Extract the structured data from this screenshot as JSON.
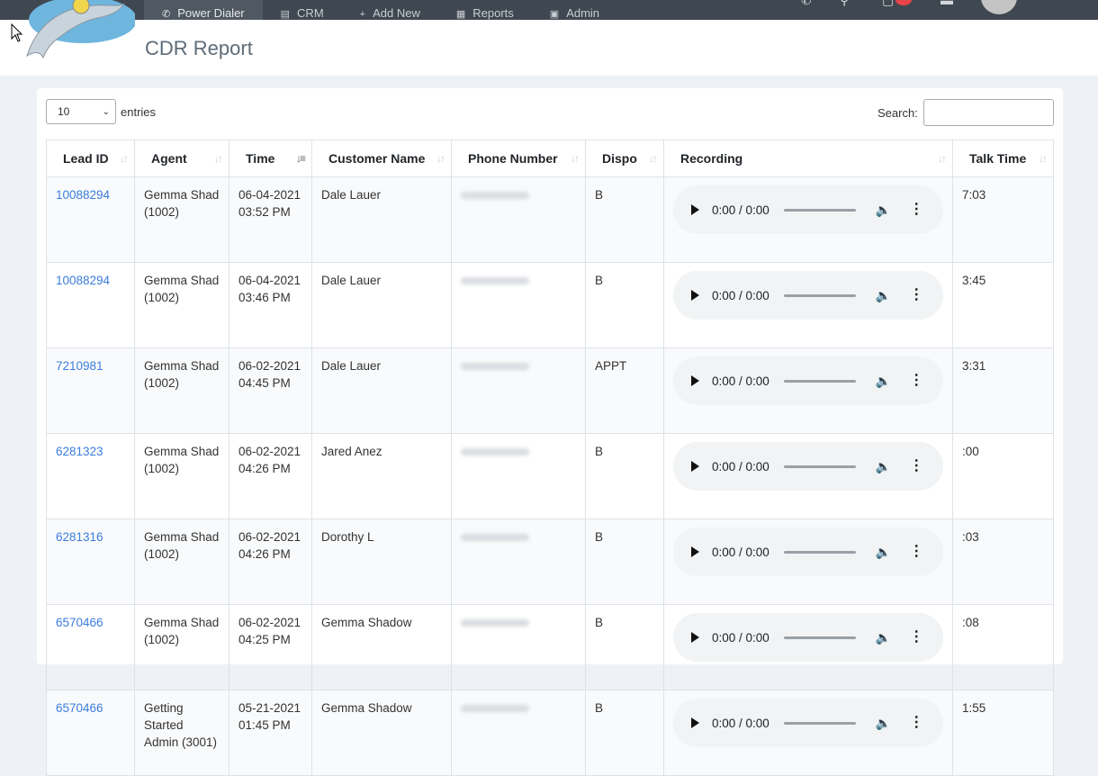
{
  "nav": {
    "items": [
      {
        "label": "Power Dialer",
        "icon": "phone-icon",
        "active": true
      },
      {
        "label": "CRM",
        "icon": "contact-card-icon"
      },
      {
        "label": "Add New",
        "icon": "plus-icon"
      },
      {
        "label": "Reports",
        "icon": "report-icon"
      },
      {
        "label": "Admin",
        "icon": "admin-icon"
      }
    ]
  },
  "header": {
    "title": "CDR Report"
  },
  "table_controls": {
    "length_value": "10",
    "length_label": "entries",
    "search_label": "Search:",
    "search_value": ""
  },
  "table": {
    "columns": [
      "Lead ID",
      "Agent",
      "Time",
      "Customer Name",
      "Phone Number",
      "Dispo",
      "Recording",
      "Talk Time"
    ],
    "rows": [
      {
        "lead_id": "10088294",
        "agent": "Gemma Shad (1002)",
        "time": "06-04-2021 03:52 PM",
        "customer": "Dale Lauer",
        "dispo": "B",
        "recording": "0:00 / 0:00",
        "talk_time": "7:03"
      },
      {
        "lead_id": "10088294",
        "agent": "Gemma Shad (1002)",
        "time": "06-04-2021 03:46 PM",
        "customer": "Dale Lauer",
        "dispo": "B",
        "recording": "0:00 / 0:00",
        "talk_time": "3:45"
      },
      {
        "lead_id": "7210981",
        "agent": "Gemma Shad (1002)",
        "time": "06-02-2021 04:45 PM",
        "customer": "Dale Lauer",
        "dispo": "APPT",
        "recording": "0:00 / 0:00",
        "talk_time": "3:31"
      },
      {
        "lead_id": "6281323",
        "agent": "Gemma Shad (1002)",
        "time": "06-02-2021 04:26 PM",
        "customer": "Jared Anez",
        "dispo": "B",
        "recording": "0:00 / 0:00",
        "talk_time": ":00"
      },
      {
        "lead_id": "6281316",
        "agent": "Gemma Shad (1002)",
        "time": "06-02-2021 04:26 PM",
        "customer": "Dorothy L",
        "dispo": "B",
        "recording": "0:00 / 0:00",
        "talk_time": ":03"
      },
      {
        "lead_id": "6570466",
        "agent": "Gemma Shad (1002)",
        "time": "06-02-2021 04:25 PM",
        "customer": "Gemma Shadow",
        "dispo": "B",
        "recording": "0:00 / 0:00",
        "talk_time": ":08"
      },
      {
        "lead_id": "6570466",
        "agent": "Getting Started Admin (3001)",
        "time": "05-21-2021 01:45 PM",
        "customer": "Gemma Shadow",
        "dispo": "B",
        "recording": "0:00 / 0:00",
        "talk_time": "1:55"
      }
    ]
  },
  "colors": {
    "link": "#3b7ddd",
    "topbar": "#3f4750",
    "badge": "#e8424a"
  }
}
